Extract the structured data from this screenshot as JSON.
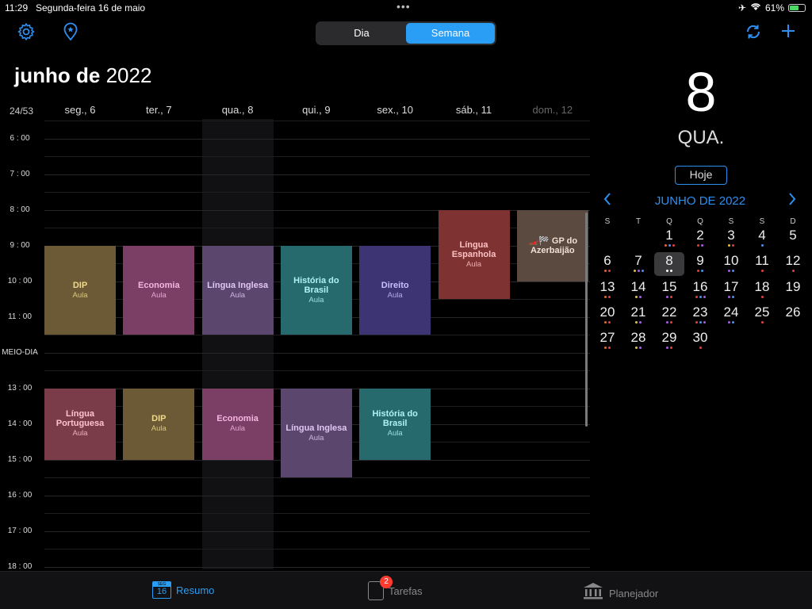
{
  "status": {
    "time": "11:29",
    "date": "Segunda-feira 16 de maio",
    "battery": "61%",
    "battery_level": 0.61
  },
  "toolbar": {
    "segments": [
      {
        "label": "Dia",
        "active": false
      },
      {
        "label": "Semana",
        "active": true
      }
    ]
  },
  "title": {
    "month": "junho de",
    "year": "2022"
  },
  "week_number": "24/53",
  "days": [
    {
      "label": "seg., 6",
      "dim": false,
      "today": false
    },
    {
      "label": "ter., 7",
      "dim": false,
      "today": false
    },
    {
      "label": "qua., 8",
      "dim": false,
      "today": true
    },
    {
      "label": "qui., 9",
      "dim": false,
      "today": false
    },
    {
      "label": "sex., 10",
      "dim": false,
      "today": false
    },
    {
      "label": "sáb., 11",
      "dim": false,
      "today": false
    },
    {
      "label": "dom., 12",
      "dim": true,
      "today": false
    }
  ],
  "hours": [
    {
      "label": "6 : 00",
      "hour": 6
    },
    {
      "label": "7 : 00",
      "hour": 7
    },
    {
      "label": "8 : 00",
      "hour": 8
    },
    {
      "label": "9 : 00",
      "hour": 9
    },
    {
      "label": "10 : 00",
      "hour": 10
    },
    {
      "label": "11 : 00",
      "hour": 11
    },
    {
      "label": "MEIO-DIA",
      "hour": 12
    },
    {
      "label": "13 : 00",
      "hour": 13
    },
    {
      "label": "14 : 00",
      "hour": 14
    },
    {
      "label": "15 : 00",
      "hour": 15
    },
    {
      "label": "16 : 00",
      "hour": 16
    },
    {
      "label": "17 : 00",
      "hour": 17
    },
    {
      "label": "18 : 00",
      "hour": 18
    }
  ],
  "events": [
    {
      "day": 0,
      "start": 9,
      "end": 11.5,
      "title": "DIP",
      "sub": "Aula",
      "color": "#6b5a35",
      "text": "#f2d98a"
    },
    {
      "day": 1,
      "start": 9,
      "end": 11.5,
      "title": "Economia",
      "sub": "Aula",
      "color": "#7b3f65",
      "text": "#f6b5e0"
    },
    {
      "day": 2,
      "start": 9,
      "end": 11.5,
      "title": "Língua Inglesa",
      "sub": "Aula",
      "color": "#5b476e",
      "text": "#e0c6f2"
    },
    {
      "day": 3,
      "start": 9,
      "end": 11.5,
      "title": "História do Brasil",
      "sub": "Aula",
      "color": "#276a6e",
      "text": "#aef2f5"
    },
    {
      "day": 4,
      "start": 9,
      "end": 11.5,
      "title": "Direito",
      "sub": "Aula",
      "color": "#3d3573",
      "text": "#c8c0ff"
    },
    {
      "day": 5,
      "start": 8,
      "end": 10.5,
      "title": "Língua Espanhola",
      "sub": "Aula",
      "color": "#7e3232",
      "text": "#ffc1c1"
    },
    {
      "day": 6,
      "start": 8,
      "end": 10,
      "title": "🏎️🏁 GP do Azerbaijão",
      "sub": "",
      "color": "#5a4a40",
      "text": "#f0e0d6"
    },
    {
      "day": 0,
      "start": 13,
      "end": 15,
      "title": "Língua Portuguesa",
      "sub": "Aula",
      "color": "#7a3c48",
      "text": "#ffc2ce"
    },
    {
      "day": 1,
      "start": 13,
      "end": 15,
      "title": "DIP",
      "sub": "Aula",
      "color": "#6b5a35",
      "text": "#f2d98a"
    },
    {
      "day": 2,
      "start": 13,
      "end": 15,
      "title": "Economia",
      "sub": "Aula",
      "color": "#7b3f65",
      "text": "#f6b5e0"
    },
    {
      "day": 3,
      "start": 13,
      "end": 15.5,
      "title": "Língua Inglesa",
      "sub": "Aula",
      "color": "#5b476e",
      "text": "#e0c6f2"
    },
    {
      "day": 4,
      "start": 13,
      "end": 15,
      "title": "História do Brasil",
      "sub": "Aula",
      "color": "#276a6e",
      "text": "#aef2f5"
    }
  ],
  "side": {
    "big_day": "8",
    "big_weekday": "QUA.",
    "today_label": "Hoje",
    "cal_title": "JUNHO DE 2022",
    "weekdays": [
      "S",
      "T",
      "Q",
      "Q",
      "S",
      "S",
      "D"
    ],
    "weeks": [
      [
        null,
        null,
        1,
        2,
        3,
        4,
        5
      ],
      [
        6,
        7,
        8,
        9,
        10,
        11,
        12
      ],
      [
        13,
        14,
        15,
        16,
        17,
        18,
        19
      ],
      [
        20,
        21,
        22,
        23,
        24,
        25,
        26
      ],
      [
        27,
        28,
        29,
        30,
        null,
        null,
        null
      ]
    ],
    "selected": 8,
    "day_dots": {
      "1": [
        "#e0663a",
        "#4a8ff0",
        "#e04040"
      ],
      "2": [
        "#e04040",
        "#a060e0"
      ],
      "3": [
        "#e0c040",
        "#e04040"
      ],
      "4": [
        "#4a8ff0"
      ],
      "6": [
        "#e0663a",
        "#e04040"
      ],
      "7": [
        "#e0c040",
        "#a060e0",
        "#4a8ff0"
      ],
      "8": [
        "#ffffff",
        "#ffffff"
      ],
      "9": [
        "#e04040",
        "#4a8ff0"
      ],
      "10": [
        "#a060e0",
        "#4a8ff0"
      ],
      "11": [
        "#e04040"
      ],
      "12": [
        "#e04040"
      ],
      "13": [
        "#e0663a",
        "#e04040"
      ],
      "14": [
        "#e0c040",
        "#a060e0"
      ],
      "15": [
        "#a060e0",
        "#e04040"
      ],
      "16": [
        "#e04040",
        "#4a8ff0",
        "#a060e0"
      ],
      "17": [
        "#a060e0",
        "#4a8ff0"
      ],
      "18": [
        "#e04040"
      ],
      "20": [
        "#e0663a",
        "#e04040"
      ],
      "21": [
        "#e0c040",
        "#a060e0"
      ],
      "22": [
        "#a060e0",
        "#e04040"
      ],
      "23": [
        "#e04040",
        "#4a8ff0",
        "#a060e0"
      ],
      "24": [
        "#a060e0",
        "#4a8ff0"
      ],
      "25": [
        "#e04040"
      ],
      "27": [
        "#e0663a",
        "#e04040"
      ],
      "28": [
        "#e0c040",
        "#a060e0"
      ],
      "29": [
        "#a060e0",
        "#e04040"
      ],
      "30": [
        "#e04040"
      ]
    }
  },
  "tabs": {
    "resumo": {
      "label": "Resumo",
      "icon_top": "SEG",
      "icon_num": "16"
    },
    "tarefas": {
      "label": "Tarefas",
      "badge": "2"
    },
    "planejador": {
      "label": "Planejador"
    }
  },
  "colors": {
    "accent": "#2a9df4",
    "background": "#000000"
  }
}
